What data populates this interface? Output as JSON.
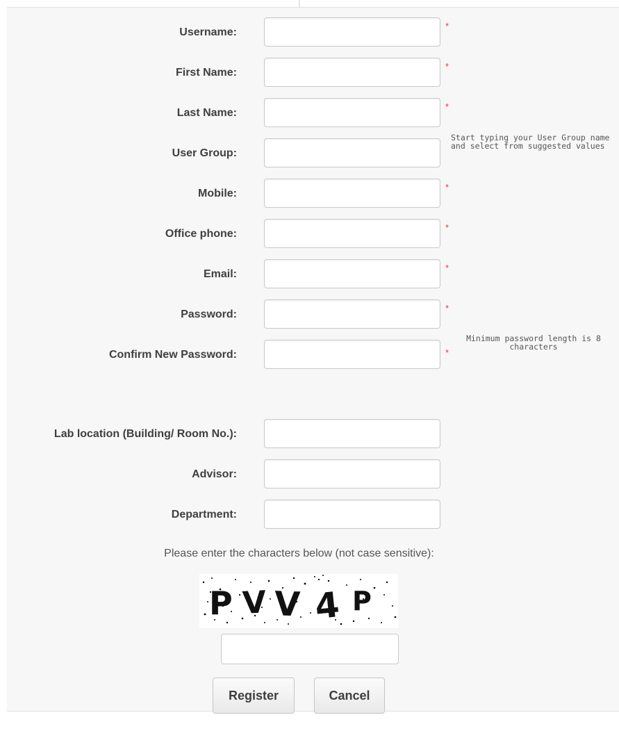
{
  "form": {
    "fields": [
      {
        "label": "Username:",
        "value": "",
        "required": true
      },
      {
        "label": "First Name:",
        "value": "",
        "required": true
      },
      {
        "label": "Last Name:",
        "value": "",
        "required": true
      },
      {
        "label": "User Group:",
        "value": "",
        "required": false
      },
      {
        "label": "Mobile:",
        "value": "",
        "required": true
      },
      {
        "label": "Office phone:",
        "value": "",
        "required": true
      },
      {
        "label": "Email:",
        "value": "",
        "required": true
      },
      {
        "label": "Password:",
        "value": "",
        "required": true
      },
      {
        "label": "Confirm New Password:",
        "value": "",
        "required": true
      },
      {
        "label": "Lab location (Building/ Room No.):",
        "value": "",
        "required": false
      },
      {
        "label": "Advisor:",
        "value": "",
        "required": false
      },
      {
        "label": "Department:",
        "value": "",
        "required": false
      }
    ],
    "required_mark": "*",
    "hint_user_group": "Start typing your User Group name and select from suggested values",
    "hint_password": "Minimum password length is 8 characters"
  },
  "captcha": {
    "prompt": "Please enter the characters below (not case sensitive):",
    "code": "PVV4P",
    "value": ""
  },
  "buttons": {
    "register": "Register",
    "cancel": "Cancel"
  },
  "colors": {
    "required": "#e8383d",
    "panel": "#f7f7f7",
    "label": "#3f3f3f"
  }
}
